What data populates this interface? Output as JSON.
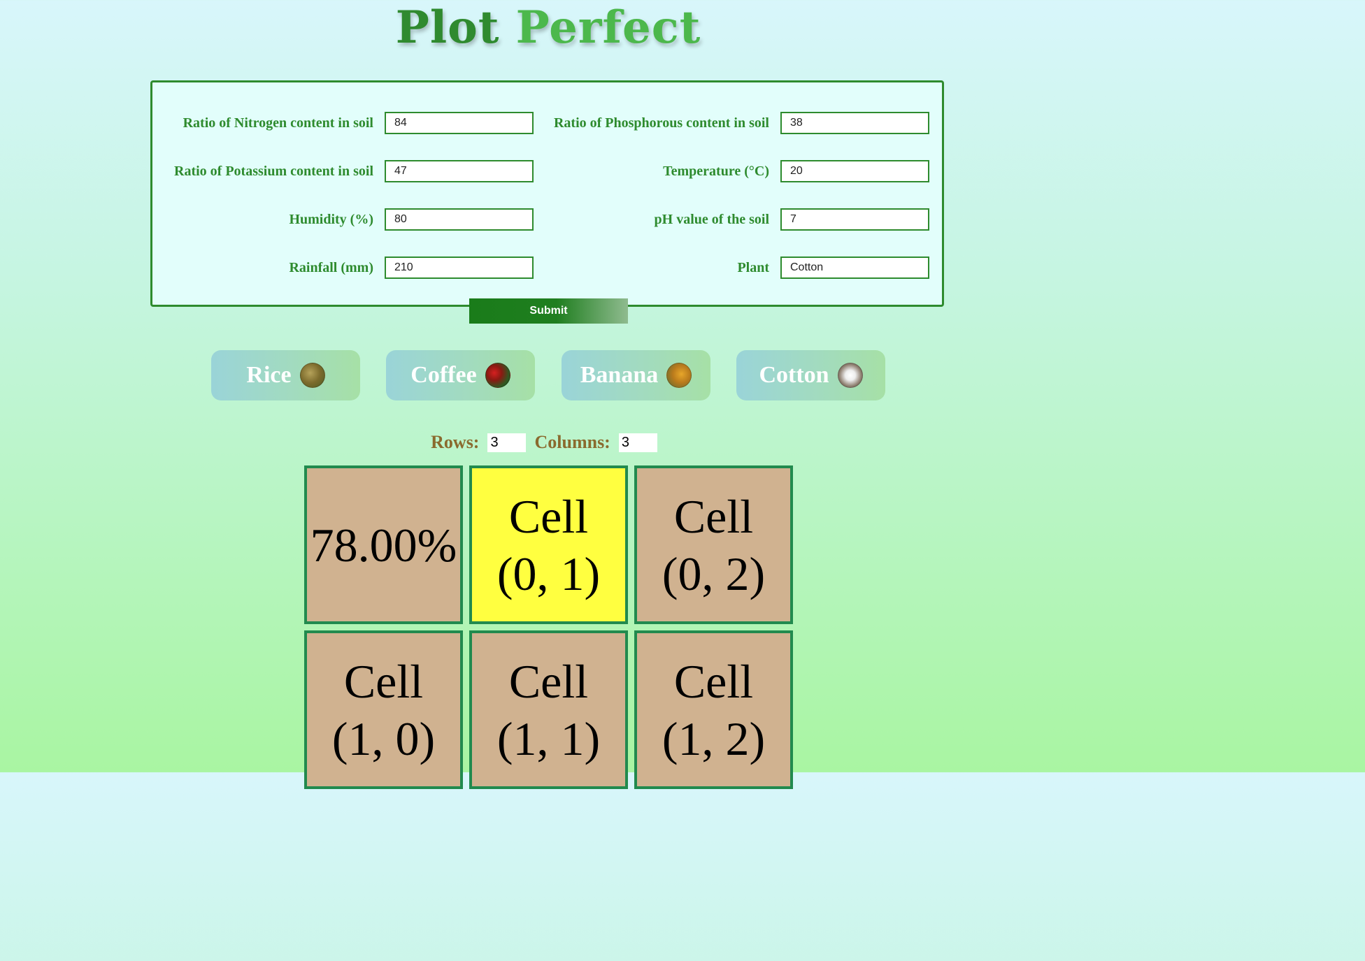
{
  "app": {
    "title_part1": "Plot",
    "title_part2": "Perfect"
  },
  "form": {
    "nitrogen": {
      "label": "Ratio of Nitrogen content in soil",
      "value": "84"
    },
    "phosphorous": {
      "label": "Ratio of Phosphorous content in soil",
      "value": "38"
    },
    "potassium": {
      "label": "Ratio of Potassium content in soil",
      "value": "47"
    },
    "temperature": {
      "label": "Temperature (°C)",
      "value": "20"
    },
    "humidity": {
      "label": "Humidity (%)",
      "value": "80"
    },
    "ph": {
      "label": "pH value of the soil",
      "value": "7"
    },
    "rainfall": {
      "label": "Rainfall (mm)",
      "value": "210"
    },
    "plant": {
      "label": "Plant",
      "value": "Cotton"
    },
    "submit_label": "Submit"
  },
  "plants": [
    {
      "label": "Rice",
      "icon": "rice-icon"
    },
    {
      "label": "Coffee",
      "icon": "coffee-icon"
    },
    {
      "label": "Banana",
      "icon": "banana-icon"
    },
    {
      "label": "Cotton",
      "icon": "cotton-icon"
    }
  ],
  "grid": {
    "rows_label": "Rows:",
    "rows_value": "3",
    "columns_label": "Columns:",
    "columns_value": "3",
    "selected_color": "#ffff40",
    "default_color": "#d0b290",
    "cells": [
      {
        "line1": "78.00%",
        "line2": "",
        "selected": false
      },
      {
        "line1": "Cell",
        "line2": "(0, 1)",
        "selected": true
      },
      {
        "line1": "Cell",
        "line2": "(0, 2)",
        "selected": false
      },
      {
        "line1": "Cell",
        "line2": "(1, 0)",
        "selected": false
      },
      {
        "line1": "Cell",
        "line2": "(1, 1)",
        "selected": false
      },
      {
        "line1": "Cell",
        "line2": "(1, 2)",
        "selected": false
      }
    ]
  }
}
